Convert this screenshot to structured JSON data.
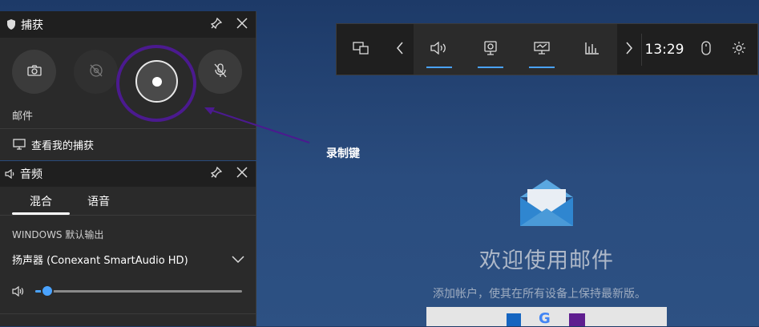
{
  "capture": {
    "title": "捕获",
    "app_name": "邮件",
    "view_captures": "查看我的捕获"
  },
  "audio": {
    "title": "音频",
    "tabs": [
      "混合",
      "语音"
    ],
    "section_label": "WINDOWS 默认输出",
    "device": "扬声器 (Conexant SmartAudio HD)",
    "volume_level": 0.06
  },
  "topbar": {
    "time": "13:29"
  },
  "annotation": {
    "label": "录制键"
  },
  "mail": {
    "title": "欢迎使用邮件",
    "subtitle": "添加帐户，使其在所有设备上保持最新版。"
  },
  "colors": {
    "highlight": "#4b1a8f",
    "accent": "#4aa3ff"
  },
  "icons": [
    "shield-icon",
    "pin-icon",
    "close-icon",
    "camera-icon",
    "screenshot-off-icon",
    "record-icon",
    "mic-off-icon",
    "monitor-icon",
    "speaker-icon",
    "chevron-down-icon",
    "widget-icon",
    "chevron-left-icon",
    "chevron-right-icon",
    "webcam-icon",
    "performance-icon",
    "chart-icon",
    "mouse-icon",
    "gear-icon",
    "mail-icon"
  ]
}
